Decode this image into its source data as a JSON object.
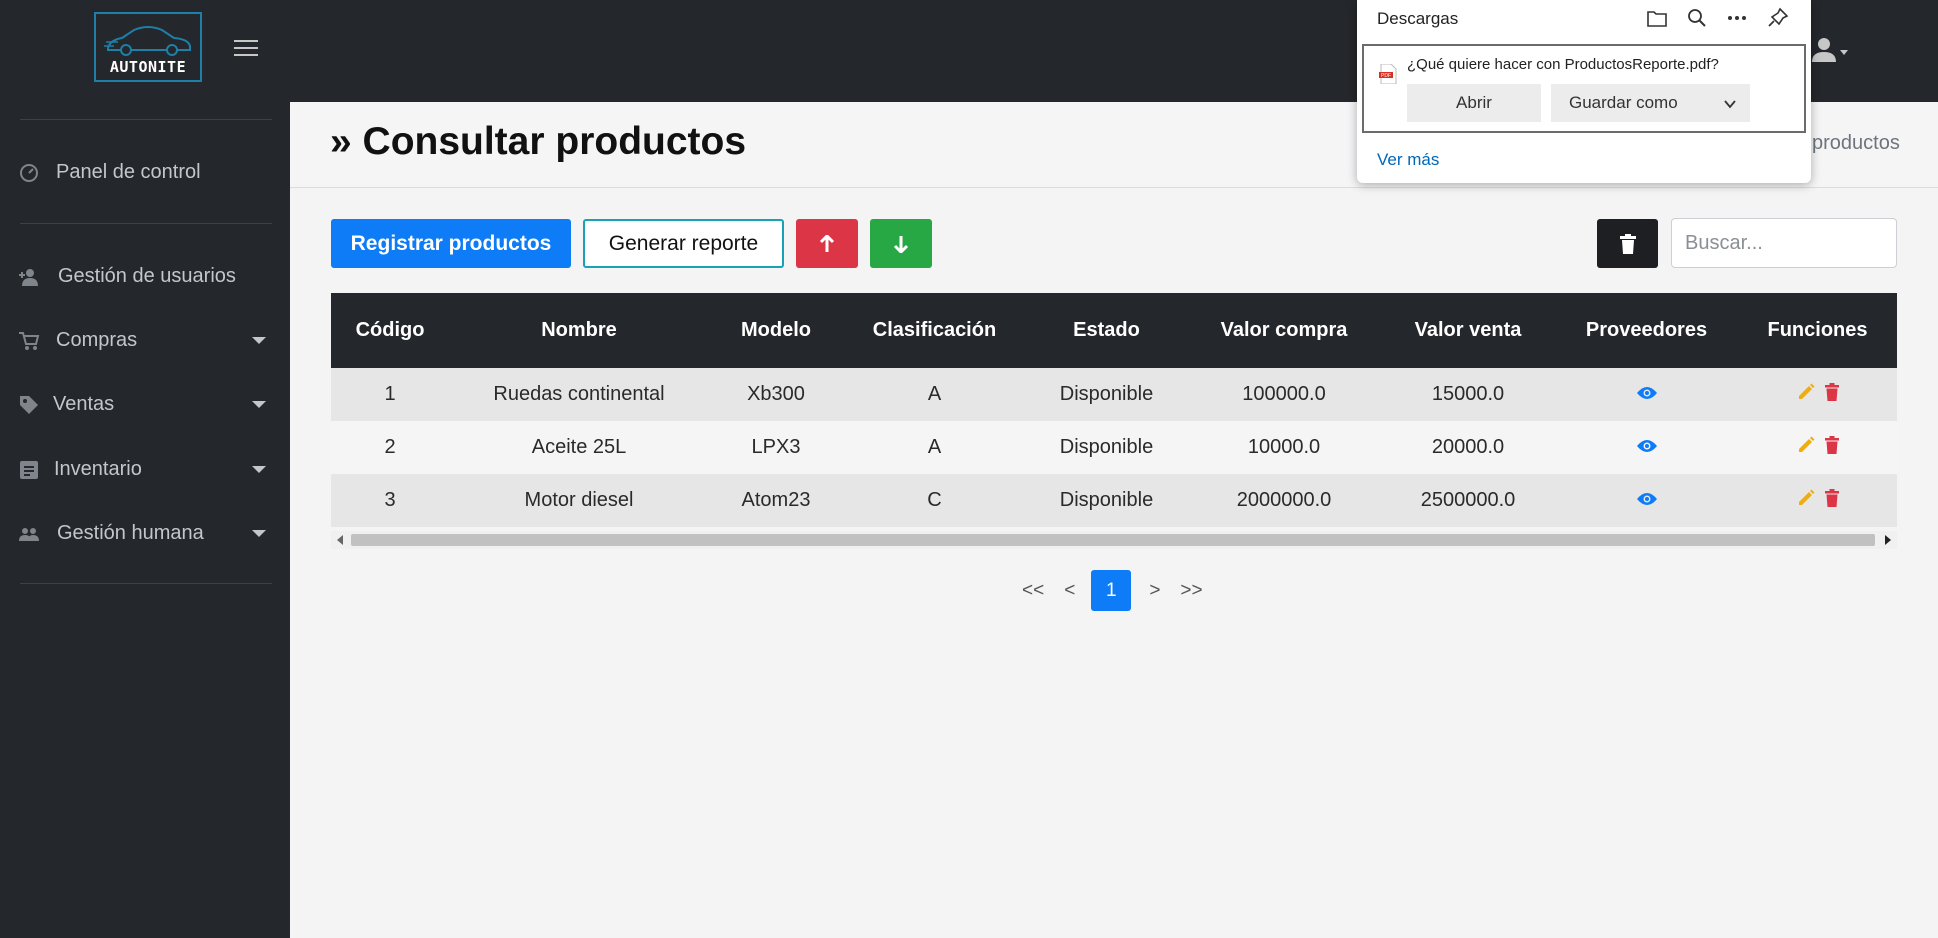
{
  "app": {
    "logo_text": "AUTONITE"
  },
  "sidebar": {
    "items": [
      {
        "label": "Panel de control",
        "icon": "dashboard-icon",
        "has_caret": false
      },
      {
        "label": "Gestión de usuarios",
        "icon": "user-plus-icon",
        "has_caret": false
      },
      {
        "label": "Compras",
        "icon": "cart-icon",
        "has_caret": true
      },
      {
        "label": "Ventas",
        "icon": "tag-icon",
        "has_caret": true
      },
      {
        "label": "Inventario",
        "icon": "list-alt-icon",
        "has_caret": true
      },
      {
        "label": "Gestión humana",
        "icon": "people-icon",
        "has_caret": true
      }
    ]
  },
  "header": {
    "title": "» Consultar productos",
    "breadcrumb_tail": "productos"
  },
  "toolbar": {
    "register_label": "Registrar productos",
    "report_label": "Generar reporte",
    "search_placeholder": "Buscar..."
  },
  "table": {
    "columns": [
      "Código",
      "Nombre",
      "Modelo",
      "Clasificación",
      "Estado",
      "Valor compra",
      "Valor venta",
      "Proveedores",
      "Funciones"
    ],
    "rows": [
      {
        "codigo": "1",
        "nombre": "Ruedas continental",
        "modelo": "Xb300",
        "clasificacion": "A",
        "estado": "Disponible",
        "valor_compra": "100000.0",
        "valor_venta": "15000.0"
      },
      {
        "codigo": "2",
        "nombre": "Aceite 25L",
        "modelo": "LPX3",
        "clasificacion": "A",
        "estado": "Disponible",
        "valor_compra": "10000.0",
        "valor_venta": "20000.0"
      },
      {
        "codigo": "3",
        "nombre": "Motor diesel",
        "modelo": "Atom23",
        "clasificacion": "C",
        "estado": "Disponible",
        "valor_compra": "2000000.0",
        "valor_venta": "2500000.0"
      }
    ]
  },
  "pagination": {
    "first": "<<",
    "prev": "<",
    "current": "1",
    "next": ">",
    "last": ">>"
  },
  "downloads": {
    "title": "Descargas",
    "question": "¿Qué quiere hacer con ProductosReporte.pdf?",
    "open_label": "Abrir",
    "save_as_label": "Guardar como",
    "see_more": "Ver más"
  },
  "colors": {
    "topbar": "#24272b",
    "primary": "#0d7cf6",
    "danger": "#dc3545",
    "success": "#28a745",
    "warning": "#f0ad10",
    "info": "#17a2b8"
  }
}
